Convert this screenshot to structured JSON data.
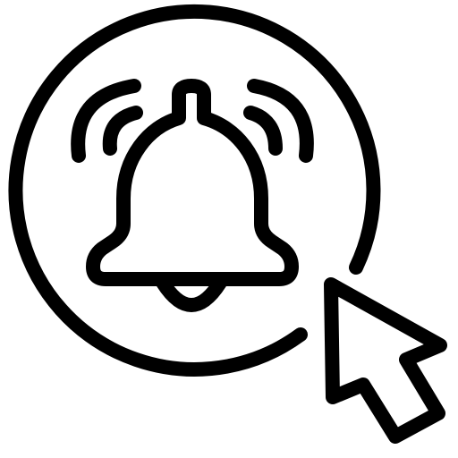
{
  "icon": {
    "name": "notification-click-icon",
    "parts": [
      "circle-frame",
      "bell",
      "sound-waves",
      "cursor-arrow"
    ],
    "stroke_color": "#000000",
    "fill_color": "#ffffff",
    "background_color": "#ffffff"
  }
}
